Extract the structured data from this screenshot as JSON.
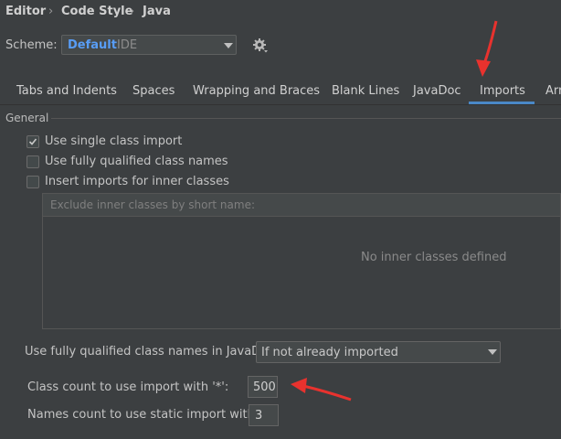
{
  "breadcrumb": {
    "items": [
      "Editor",
      "Code Style",
      "Java"
    ],
    "separator": "›"
  },
  "scheme": {
    "label": "Scheme:",
    "name": "Default",
    "kind": "IDE",
    "settings_icon": "gear-icon"
  },
  "tabs": [
    {
      "label": "Tabs and Indents"
    },
    {
      "label": "Spaces"
    },
    {
      "label": "Wrapping and Braces"
    },
    {
      "label": "Blank Lines"
    },
    {
      "label": "JavaDoc"
    },
    {
      "label": "Imports",
      "selected": true
    },
    {
      "label": "Arr"
    }
  ],
  "general": {
    "title": "General",
    "options": [
      {
        "label": "Use single class import",
        "checked": true
      },
      {
        "label": "Use fully qualified class names",
        "checked": false
      },
      {
        "label": "Insert imports for inner classes",
        "checked": false
      }
    ],
    "exclude_placeholder": "Exclude inner classes by short name:",
    "empty_text": "No inner classes defined",
    "javadoc_label": "Use fully qualified class names in JavaDoc:",
    "javadoc_value": "If not already imported",
    "class_count_label": "Class count to use import with '*':",
    "class_count_value": "500",
    "names_count_label": "Names count to use static import with '*':",
    "names_count_value": "3"
  },
  "colors": {
    "background": "#3c3f41",
    "accent": "#4a88c7",
    "scheme_name": "#589df6",
    "annotation_arrow": "#e8322e"
  }
}
